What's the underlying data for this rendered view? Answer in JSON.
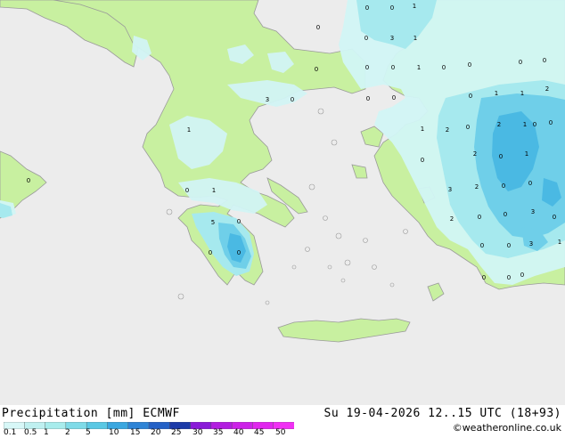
{
  "footer": {
    "title": "Precipitation [mm] ECMWF",
    "datetime": "Su 19-04-2026 12..15 UTC (18+93)",
    "credit": "©weatheronline.co.uk"
  },
  "legend": {
    "ticks": [
      "0.1",
      "0.5",
      "1",
      "2",
      "5",
      "10",
      "15",
      "20",
      "25",
      "30",
      "35",
      "40",
      "45",
      "50"
    ],
    "colors": [
      "#d7f7f7",
      "#bff0f0",
      "#a8ecec",
      "#7fdbe8",
      "#5ac8e4",
      "#3aa7e0",
      "#2e84d6",
      "#2461c6",
      "#1c3aa8",
      "#8a1ad8",
      "#b21ee0",
      "#cc22e8",
      "#e026ee",
      "#f030f4"
    ]
  },
  "map_colors": {
    "sea": "#ececec",
    "land": "#c8f0a0",
    "precip_light": "#d2f5f5",
    "precip_mid": "#a6e9ee",
    "precip_heavy": "#6fcfe9",
    "precip_max": "#4ab9e3",
    "coast": "#9a9a9a"
  },
  "grid_values": [
    {
      "v": "0",
      "k": "p0"
    },
    {
      "v": "0",
      "k": "p1"
    },
    {
      "v": "1",
      "k": "p2"
    },
    {
      "v": "0",
      "k": "p3"
    },
    {
      "v": "3",
      "k": "p4"
    },
    {
      "v": "1",
      "k": "p5"
    },
    {
      "v": "0",
      "k": "p6"
    },
    {
      "v": "0",
      "k": "p7"
    },
    {
      "v": "0",
      "k": "p8"
    },
    {
      "v": "1",
      "k": "p9"
    },
    {
      "v": "0",
      "k": "p10"
    },
    {
      "v": "0",
      "k": "p11"
    },
    {
      "v": "0",
      "k": "p12"
    },
    {
      "v": "0",
      "k": "p13"
    },
    {
      "v": "1",
      "k": "p14"
    },
    {
      "v": "0",
      "k": "p15"
    },
    {
      "v": "0",
      "k": "p16"
    },
    {
      "v": "0",
      "k": "p17"
    },
    {
      "v": "1",
      "k": "p18"
    },
    {
      "v": "2",
      "k": "p19"
    },
    {
      "v": "3",
      "k": "p20"
    },
    {
      "v": "0",
      "k": "p21"
    },
    {
      "v": "1",
      "k": "p22"
    },
    {
      "v": "2",
      "k": "p23"
    },
    {
      "v": "1",
      "k": "p24"
    },
    {
      "v": "0",
      "k": "p25"
    },
    {
      "v": "1",
      "k": "p26"
    },
    {
      "v": "2",
      "k": "p27"
    },
    {
      "v": "2",
      "k": "p28"
    },
    {
      "v": "0",
      "k": "p29"
    },
    {
      "v": "1",
      "k": "p30"
    },
    {
      "v": "0",
      "k": "p31"
    },
    {
      "v": "0",
      "k": "p32"
    },
    {
      "v": "0",
      "k": "p33"
    },
    {
      "v": "1",
      "k": "p34"
    },
    {
      "v": "3",
      "k": "p35"
    },
    {
      "v": "2",
      "k": "p36"
    },
    {
      "v": "0",
      "k": "p37"
    },
    {
      "v": "0",
      "k": "p38"
    },
    {
      "v": "0",
      "k": "p39"
    },
    {
      "v": "2",
      "k": "p40"
    },
    {
      "v": "0",
      "k": "p41"
    },
    {
      "v": "0",
      "k": "p42"
    },
    {
      "v": "3",
      "k": "p43"
    },
    {
      "v": "3",
      "k": "p44"
    },
    {
      "v": "1",
      "k": "p45"
    },
    {
      "v": "5",
      "k": "p46"
    },
    {
      "v": "0",
      "k": "p47"
    },
    {
      "v": "0",
      "k": "p48"
    },
    {
      "v": "0",
      "k": "p49"
    },
    {
      "v": "0",
      "k": "p50"
    },
    {
      "v": "0",
      "k": "p51"
    },
    {
      "v": "0",
      "k": "p52"
    },
    {
      "v": "0",
      "k": "p53"
    },
    {
      "v": "0",
      "k": "p54"
    },
    {
      "v": "0",
      "k": "p55"
    },
    {
      "v": "0",
      "k": "p56"
    },
    {
      "v": "0",
      "k": "p57"
    }
  ]
}
